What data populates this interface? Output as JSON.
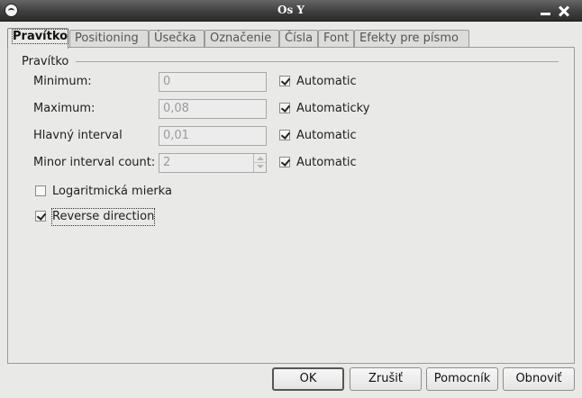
{
  "window": {
    "title": "Os Y"
  },
  "tabs": [
    {
      "label": "Pravítko",
      "active": true
    },
    {
      "label": "Positioning"
    },
    {
      "label": "Úsečka"
    },
    {
      "label": "Označenie"
    },
    {
      "label": "Čísla"
    },
    {
      "label": "Font"
    },
    {
      "label": "Efekty pre písmo"
    }
  ],
  "scale": {
    "group_title": "Pravítko",
    "minimum": {
      "label": "Minimum:",
      "value": "0",
      "auto_label": "Automatic",
      "auto_checked": true
    },
    "maximum": {
      "label": "Maximum:",
      "value": "0,08",
      "auto_label": "Automaticky",
      "auto_checked": true
    },
    "major_interval": {
      "label": "Hlavný interval",
      "value": "0,01",
      "auto_label": "Automatic",
      "auto_checked": true
    },
    "minor_count": {
      "label": "Minor interval count:",
      "value": "2",
      "auto_label": "Automatic",
      "auto_checked": true
    },
    "logarithmic": {
      "label": "Logaritmická mierka",
      "checked": false
    },
    "reverse": {
      "label": "Reverse direction",
      "checked": true
    }
  },
  "buttons": {
    "ok": "OK",
    "cancel": "Zrušiť",
    "help": "Pomocník",
    "reset": "Obnoviť"
  }
}
